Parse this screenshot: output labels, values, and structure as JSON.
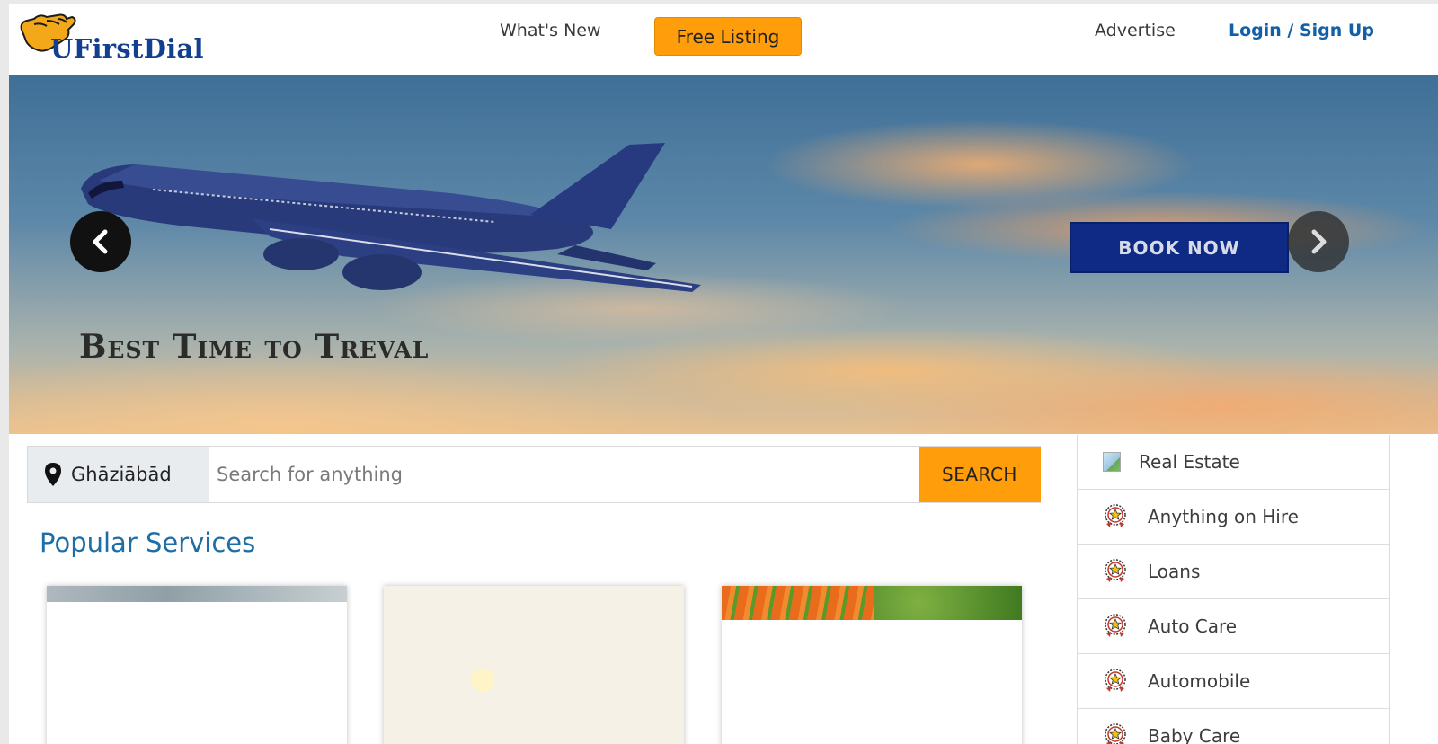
{
  "header": {
    "logo_text": "UFirstDial",
    "nav": {
      "whats_new": "What's New",
      "free_listing": "Free Listing",
      "advertise": "Advertise",
      "login_signup": "Login / Sign Up"
    }
  },
  "hero": {
    "caption": "Best Time to Treval",
    "cta": "BOOK NOW",
    "prev_icon": "chevron-left-icon",
    "next_icon": "chevron-right-icon"
  },
  "search": {
    "location": "Ghāziābād",
    "placeholder": "Search for anything",
    "button": "SEARCH"
  },
  "popular": {
    "title": "Popular Services"
  },
  "sidebar": {
    "items": [
      {
        "label": "Real Estate",
        "icon": "broken-image-icon"
      },
      {
        "label": "Anything on Hire",
        "icon": "award-badge-icon"
      },
      {
        "label": "Loans",
        "icon": "award-badge-icon"
      },
      {
        "label": "Auto Care",
        "icon": "award-badge-icon"
      },
      {
        "label": "Automobile",
        "icon": "award-badge-icon"
      },
      {
        "label": "Baby Care",
        "icon": "award-badge-icon"
      }
    ]
  },
  "colors": {
    "accent": "#ff9d0b",
    "brand_blue": "#123f8f",
    "link_blue": "#1260a8",
    "section_title": "#1e6ea6",
    "cta_blue": "#0e2a84"
  }
}
